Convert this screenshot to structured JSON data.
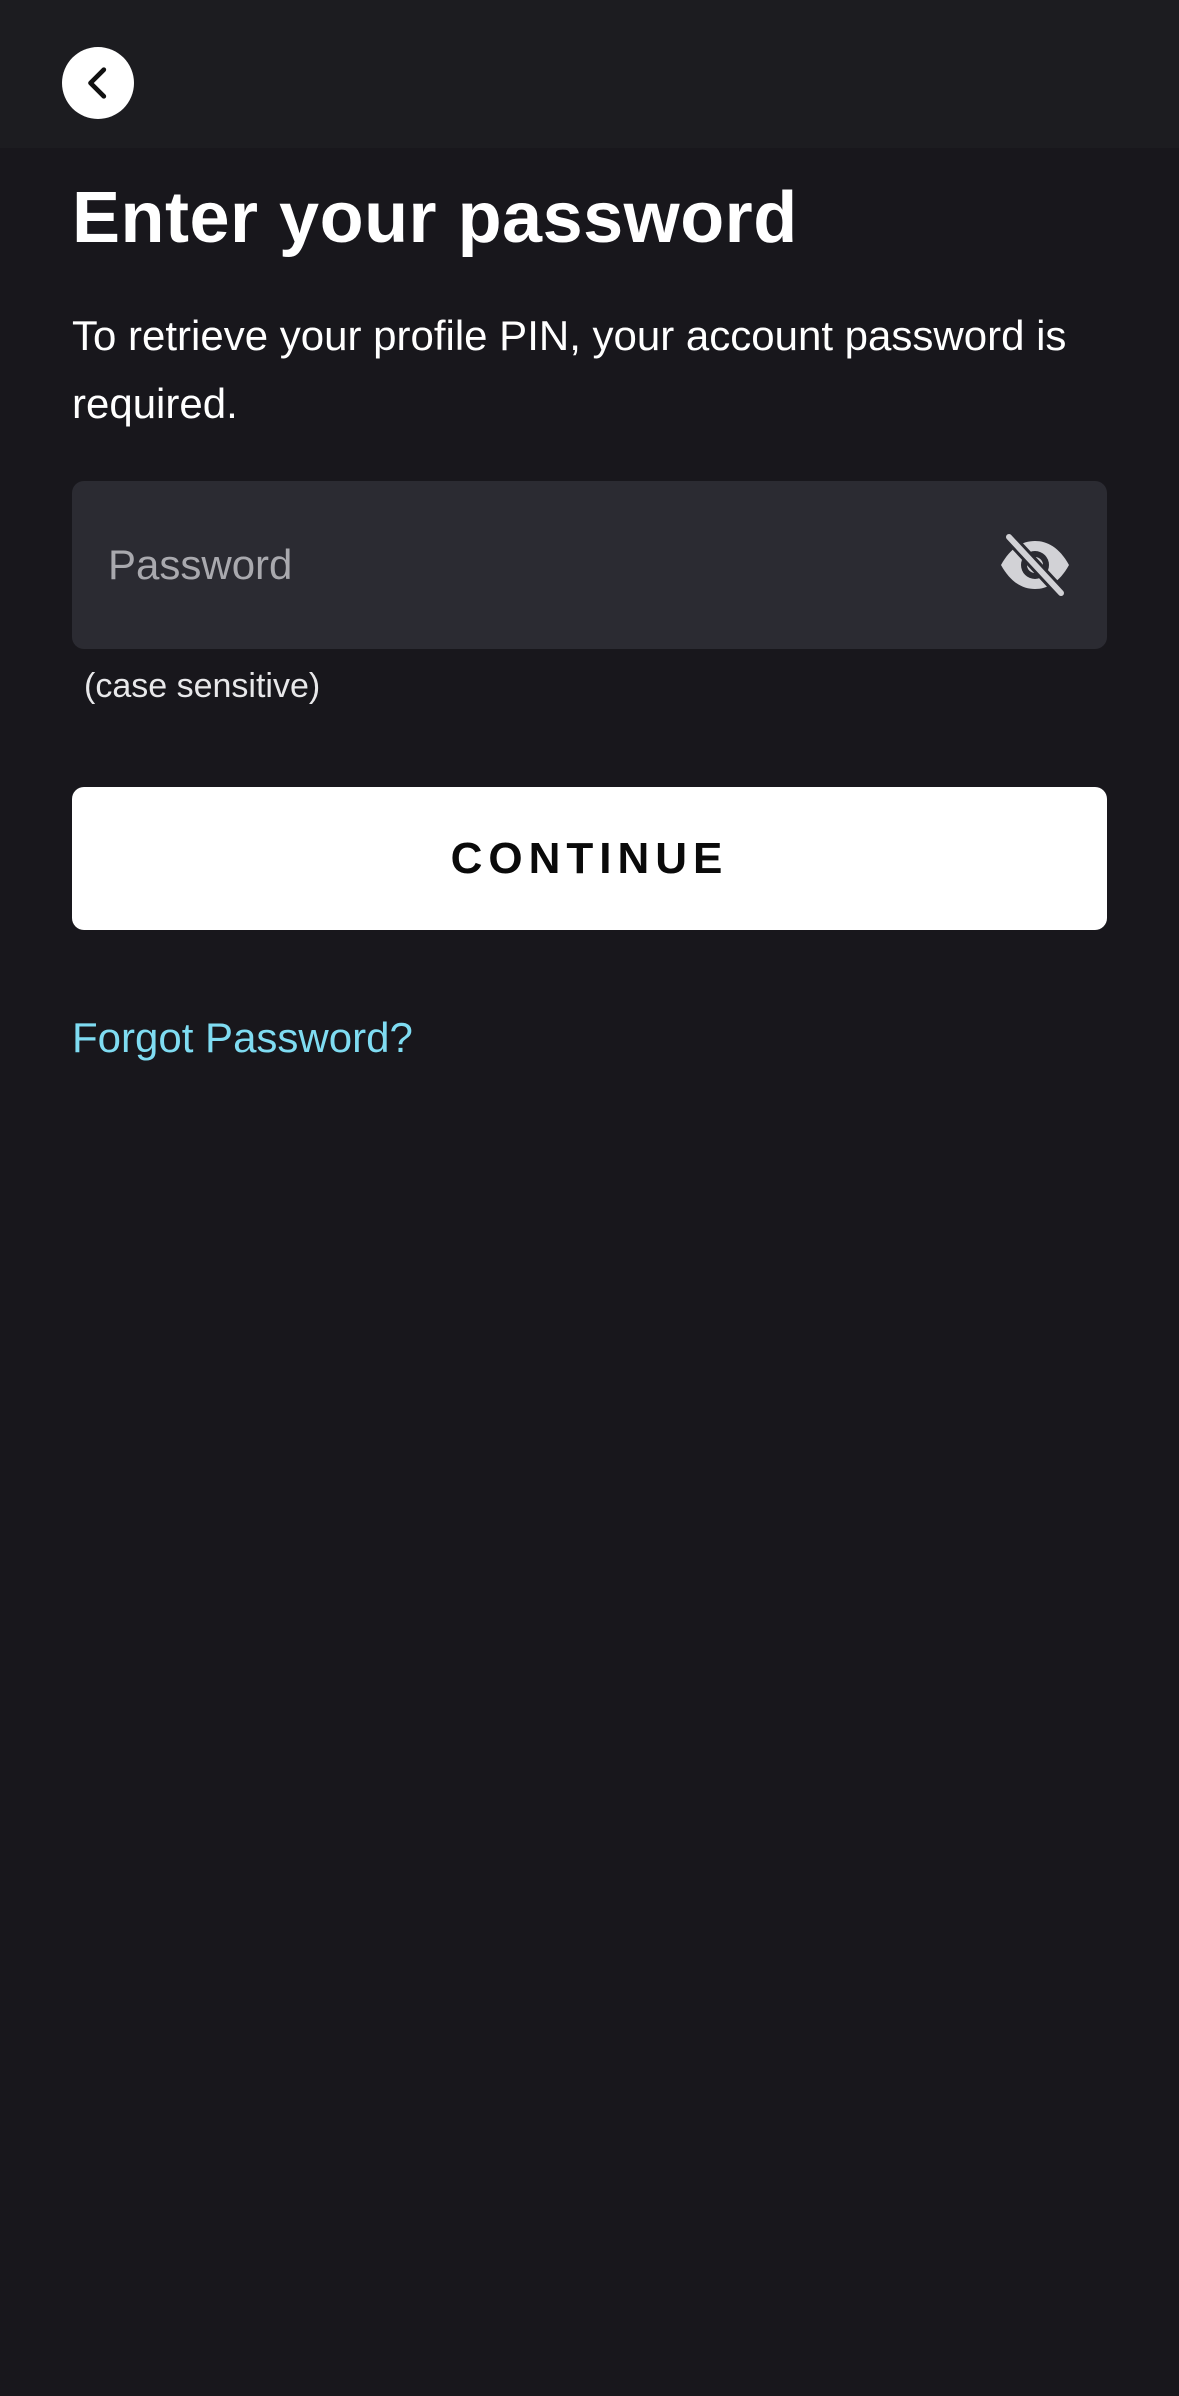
{
  "header": {
    "back_icon": "chevron-left-icon"
  },
  "main": {
    "title": "Enter your password",
    "subtitle": "To retrieve your profile PIN, your account password is required.",
    "password_field": {
      "placeholder": "Password",
      "value": "",
      "toggle_icon": "eye-off-icon"
    },
    "hint": "(case sensitive)",
    "continue_label": "CONTINUE",
    "forgot_label": "Forgot Password?"
  },
  "colors": {
    "background": "#18171c",
    "top_bar": "#1c1c20",
    "field_background": "#2b2b32",
    "button_background": "#ffffff",
    "link": "#7fdcf2"
  }
}
